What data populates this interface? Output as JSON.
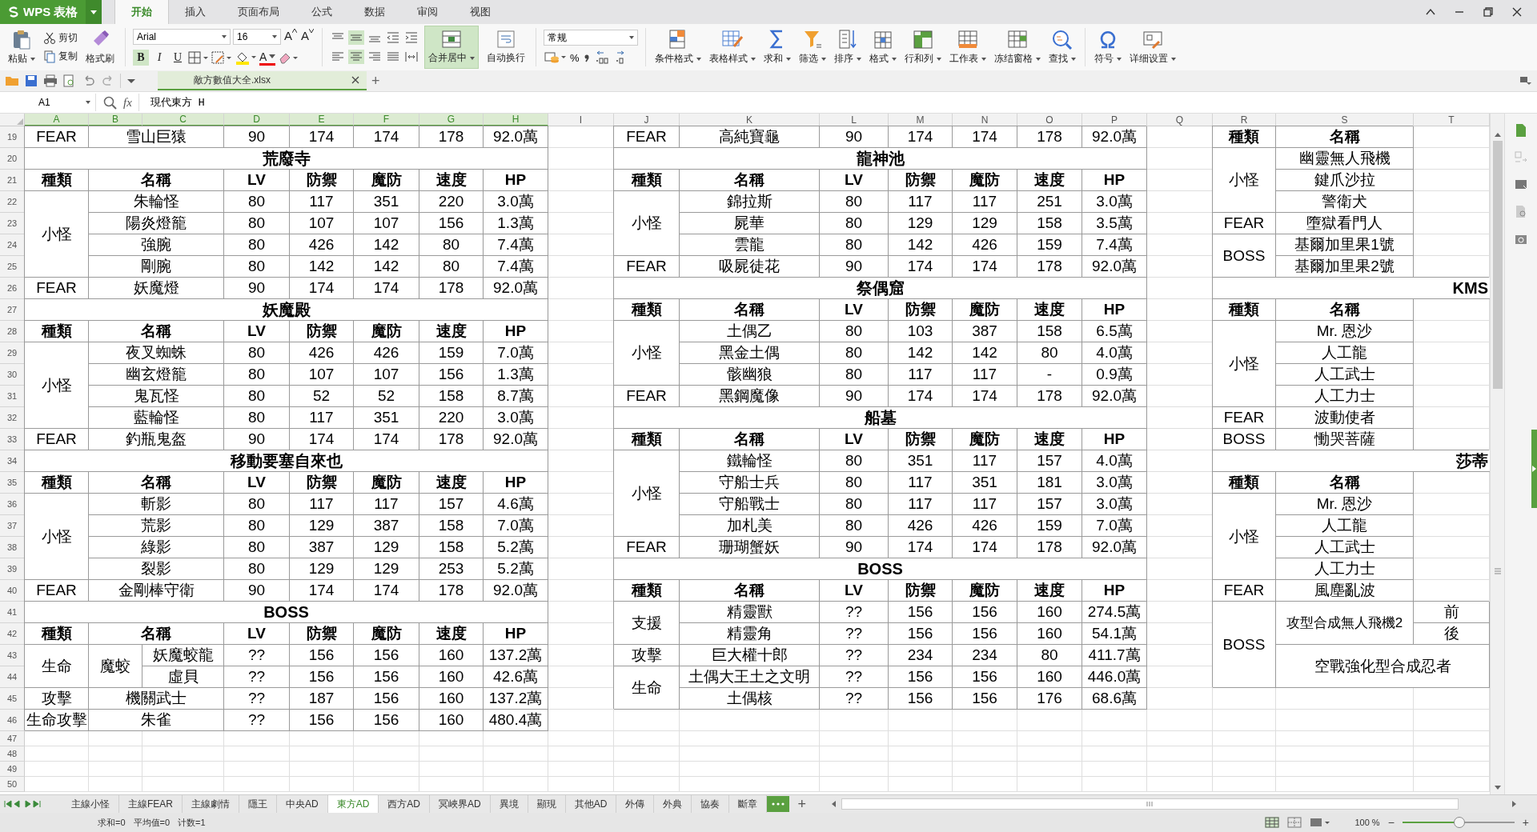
{
  "app": {
    "name": "WPS 表格"
  },
  "menu_tabs": [
    {
      "label": "开始",
      "selected": true
    },
    {
      "label": "插入",
      "selected": false
    },
    {
      "label": "页面布局",
      "selected": false
    },
    {
      "label": "公式",
      "selected": false
    },
    {
      "label": "数据",
      "selected": false
    },
    {
      "label": "审阅",
      "selected": false
    },
    {
      "label": "视图",
      "selected": false
    }
  ],
  "ribbon": {
    "paste": "粘贴",
    "cut": "剪切",
    "copy": "复制",
    "format_painter": "格式刷",
    "font": "Arial",
    "font_size": "16",
    "size_steps": [
      "A",
      "A"
    ],
    "styles": [
      {
        "label": "B",
        "selected": true
      },
      {
        "label": "I",
        "selected": false
      },
      {
        "label": "U",
        "selected": false
      }
    ],
    "font_color": "A",
    "vertical_align": [
      {
        "selected": false
      },
      {
        "selected": true
      },
      {
        "selected": false
      }
    ],
    "horizontal_align": [
      {
        "selected": false
      },
      {
        "selected": true
      },
      {
        "selected": false
      },
      {
        "selected": false
      }
    ],
    "merge": {
      "label": "合并居中",
      "selected": true
    },
    "wrap": {
      "label": "自动换行",
      "selected": false
    },
    "number_format": "常规",
    "percent": "%",
    "tools": [
      {
        "label": "条件格式",
        "kind": "conditional"
      },
      {
        "label": "表格样式",
        "kind": "table-style"
      },
      {
        "label": "求和",
        "kind": "sum"
      },
      {
        "label": "筛选",
        "kind": "filter"
      },
      {
        "label": "排序",
        "kind": "sort"
      },
      {
        "label": "格式",
        "kind": "format"
      },
      {
        "label": "行和列",
        "kind": "rows-cols"
      },
      {
        "label": "工作表",
        "kind": "sheet"
      },
      {
        "label": "冻结窗格",
        "kind": "freeze"
      },
      {
        "label": "查找",
        "kind": "find"
      },
      {
        "label": "符号",
        "kind": "symbol"
      },
      {
        "label": "详细设置",
        "kind": "settings"
      }
    ]
  },
  "quick_bar": {
    "document_tab": "敵方數值大全.xlsx",
    "new_tab": "+"
  },
  "formula_bar": {
    "cell": "A1",
    "fx": "fx",
    "value": "現代東方 H"
  },
  "sheet": {
    "columns": [
      {
        "label": "A",
        "selected": true
      },
      {
        "label": "B",
        "selected": true
      },
      {
        "label": "C",
        "selected": true
      },
      {
        "label": "D",
        "selected": true
      },
      {
        "label": "E",
        "selected": true
      },
      {
        "label": "F",
        "selected": true
      },
      {
        "label": "G",
        "selected": true
      },
      {
        "label": "H",
        "selected": true
      },
      {
        "label": "I",
        "selected": false
      },
      {
        "label": "J",
        "selected": false
      },
      {
        "label": "K",
        "selected": false
      },
      {
        "label": "L",
        "selected": false
      },
      {
        "label": "M",
        "selected": false
      },
      {
        "label": "N",
        "selected": false
      },
      {
        "label": "O",
        "selected": false
      },
      {
        "label": "P",
        "selected": false
      },
      {
        "label": "Q",
        "selected": false
      },
      {
        "label": "R",
        "selected": false
      },
      {
        "label": "S",
        "selected": false
      },
      {
        "label": "T",
        "selected": false
      }
    ],
    "rows": [
      "19",
      "20",
      "21",
      "22",
      "23",
      "24",
      "25",
      "26",
      "27",
      "28",
      "29",
      "30",
      "31",
      "32",
      "33",
      "34",
      "35",
      "36",
      "37",
      "38",
      "39",
      "40",
      "41",
      "42",
      "43",
      "44",
      "45",
      "46",
      "47",
      "48",
      "49",
      "50"
    ],
    "blocks": [
      {
        "entries": [
          {
            "kind": "group",
            "type": "FEAR",
            "rows": [
              [
                "雪山巨猿",
                "90",
                "174",
                "174",
                "178",
                "92.0萬"
              ]
            ]
          },
          {
            "kind": "title",
            "text": "荒廢寺",
            "cut": false
          },
          {
            "kind": "header",
            "cells": [
              "種類",
              "名稱",
              "LV",
              "防禦",
              "魔防",
              "速度",
              "HP"
            ]
          },
          {
            "kind": "group",
            "type": "小怪",
            "rows": [
              [
                "朱輪怪",
                "80",
                "117",
                "351",
                "220",
                "3.0萬"
              ],
              [
                "陽炎燈籠",
                "80",
                "107",
                "107",
                "156",
                "1.3萬"
              ],
              [
                "強腕",
                "80",
                "426",
                "142",
                "80",
                "7.4萬"
              ],
              [
                "剛腕",
                "80",
                "142",
                "142",
                "80",
                "7.4萬"
              ]
            ]
          },
          {
            "kind": "group",
            "type": "FEAR",
            "rows": [
              [
                "妖魔燈",
                "90",
                "174",
                "174",
                "178",
                "92.0萬"
              ]
            ]
          },
          {
            "kind": "title",
            "text": "妖魔殿",
            "cut": false
          },
          {
            "kind": "header",
            "cells": [
              "種類",
              "名稱",
              "LV",
              "防禦",
              "魔防",
              "速度",
              "HP"
            ]
          },
          {
            "kind": "group",
            "type": "小怪",
            "rows": [
              [
                "夜叉蜘蛛",
                "80",
                "426",
                "426",
                "159",
                "7.0萬"
              ],
              [
                "幽玄燈籠",
                "80",
                "107",
                "107",
                "156",
                "1.3萬"
              ],
              [
                "鬼瓦怪",
                "80",
                "52",
                "52",
                "158",
                "8.7萬"
              ],
              [
                "藍輪怪",
                "80",
                "117",
                "351",
                "220",
                "3.0萬"
              ]
            ]
          },
          {
            "kind": "group",
            "type": "FEAR",
            "rows": [
              [
                "釣瓶鬼盔",
                "90",
                "174",
                "174",
                "178",
                "92.0萬"
              ]
            ]
          },
          {
            "kind": "title",
            "text": "移動要塞自來也",
            "cut": false
          },
          {
            "kind": "header",
            "cells": [
              "種類",
              "名稱",
              "LV",
              "防禦",
              "魔防",
              "速度",
              "HP"
            ]
          },
          {
            "kind": "group",
            "type": "小怪",
            "rows": [
              [
                "斬影",
                "80",
                "117",
                "117",
                "157",
                "4.6萬"
              ],
              [
                "荒影",
                "80",
                "129",
                "387",
                "158",
                "7.0萬"
              ],
              [
                "綠影",
                "80",
                "387",
                "129",
                "158",
                "5.2萬"
              ],
              [
                "裂影",
                "80",
                "129",
                "129",
                "253",
                "5.2萬"
              ]
            ]
          },
          {
            "kind": "group",
            "type": "FEAR",
            "rows": [
              [
                "金剛棒守衛",
                "90",
                "174",
                "174",
                "178",
                "92.0萬"
              ]
            ]
          },
          {
            "kind": "title",
            "text": "BOSS",
            "cut": false
          },
          {
            "kind": "header",
            "cells": [
              "種類",
              "名稱",
              "LV",
              "防禦",
              "魔防",
              "速度",
              "HP"
            ]
          },
          {
            "kind": "group",
            "type": "生命",
            "subgroup": "魔蛟",
            "rows": [
              [
                "妖魔蛟龍",
                "??",
                "156",
                "156",
                "160",
                "137.2萬"
              ],
              [
                "虛貝",
                "??",
                "156",
                "156",
                "160",
                "42.6萬"
              ]
            ]
          },
          {
            "kind": "group",
            "type": "攻擊",
            "rows": [
              [
                "機關武士",
                "??",
                "187",
                "156",
                "160",
                "137.2萬"
              ]
            ]
          },
          {
            "kind": "group",
            "type": "生命攻擊",
            "rows": [
              [
                "朱雀",
                "??",
                "156",
                "156",
                "160",
                "480.4萬"
              ]
            ]
          }
        ]
      },
      {
        "entries": [
          {
            "kind": "group",
            "type": "FEAR",
            "rows": [
              [
                "高純寶龜",
                "90",
                "174",
                "174",
                "178",
                "92.0萬"
              ]
            ]
          },
          {
            "kind": "title",
            "text": "龍神池",
            "cut": false
          },
          {
            "kind": "header",
            "cells": [
              "種類",
              "名稱",
              "LV",
              "防禦",
              "魔防",
              "速度",
              "HP"
            ]
          },
          {
            "kind": "group",
            "type": "小怪",
            "rows": [
              [
                "錦拉斯",
                "80",
                "117",
                "117",
                "251",
                "3.0萬"
              ],
              [
                "屍華",
                "80",
                "129",
                "129",
                "158",
                "3.5萬"
              ],
              [
                "雲龍",
                "80",
                "142",
                "426",
                "159",
                "7.4萬"
              ]
            ]
          },
          {
            "kind": "group",
            "type": "FEAR",
            "rows": [
              [
                "吸屍徒花",
                "90",
                "174",
                "174",
                "178",
                "92.0萬"
              ]
            ]
          },
          {
            "kind": "title",
            "text": "祭偶窟",
            "cut": false
          },
          {
            "kind": "header",
            "cells": [
              "種類",
              "名稱",
              "LV",
              "防禦",
              "魔防",
              "速度",
              "HP"
            ]
          },
          {
            "kind": "group",
            "type": "小怪",
            "rows": [
              [
                "土偶乙",
                "80",
                "103",
                "387",
                "158",
                "6.5萬"
              ],
              [
                "黑金土偶",
                "80",
                "142",
                "142",
                "80",
                "4.0萬"
              ],
              [
                "骸幽狼",
                "80",
                "117",
                "117",
                "-",
                "0.9萬"
              ]
            ]
          },
          {
            "kind": "group",
            "type": "FEAR",
            "rows": [
              [
                "黑鋼魔像",
                "90",
                "174",
                "174",
                "178",
                "92.0萬"
              ]
            ]
          },
          {
            "kind": "title",
            "text": "船墓",
            "cut": false
          },
          {
            "kind": "header",
            "cells": [
              "種類",
              "名稱",
              "LV",
              "防禦",
              "魔防",
              "速度",
              "HP"
            ]
          },
          {
            "kind": "group",
            "type": "小怪",
            "rows": [
              [
                "鐵輪怪",
                "80",
                "351",
                "117",
                "157",
                "4.0萬"
              ],
              [
                "守船士兵",
                "80",
                "117",
                "351",
                "181",
                "3.0萬"
              ],
              [
                "守船戰士",
                "80",
                "117",
                "117",
                "157",
                "3.0萬"
              ],
              [
                "加札美",
                "80",
                "426",
                "426",
                "159",
                "7.0萬"
              ]
            ]
          },
          {
            "kind": "group",
            "type": "FEAR",
            "rows": [
              [
                "珊瑚蟹妖",
                "90",
                "174",
                "174",
                "178",
                "92.0萬"
              ]
            ]
          },
          {
            "kind": "title",
            "text": "BOSS",
            "cut": false
          },
          {
            "kind": "header",
            "cells": [
              "種類",
              "名稱",
              "LV",
              "防禦",
              "魔防",
              "速度",
              "HP"
            ]
          },
          {
            "kind": "group",
            "type": "支援",
            "rows": [
              [
                "精靈獸",
                "??",
                "156",
                "156",
                "160",
                "274.5萬"
              ],
              [
                "精靈角",
                "??",
                "156",
                "156",
                "160",
                "54.1萬"
              ]
            ]
          },
          {
            "kind": "group",
            "type": "攻擊",
            "rows": [
              [
                "巨大權十郎",
                "??",
                "234",
                "234",
                "80",
                "411.7萬"
              ]
            ]
          },
          {
            "kind": "group",
            "type": "生命",
            "rows": [
              [
                "土偶大王土之文明",
                "??",
                "156",
                "156",
                "160",
                "446.0萬"
              ],
              [
                "土偶核",
                "??",
                "156",
                "156",
                "176",
                "68.6萬"
              ]
            ]
          }
        ]
      },
      {
        "entries": [
          {
            "kind": "header",
            "cells": [
              "種類",
              "名稱"
            ]
          },
          {
            "kind": "group",
            "type": "小怪",
            "rows": [
              [
                "幽靈無人飛機"
              ],
              [
                "鍵爪沙拉"
              ],
              [
                "警衛犬"
              ]
            ]
          },
          {
            "kind": "group",
            "type": "FEAR",
            "rows": [
              [
                "墮獄看門人"
              ]
            ]
          },
          {
            "kind": "group",
            "type": "BOSS",
            "rows": [
              [
                "基爾加里果1號"
              ],
              [
                "基爾加里果2號"
              ]
            ]
          },
          {
            "kind": "title",
            "text": "KMS",
            "cut": true
          },
          {
            "kind": "header",
            "cells": [
              "種類",
              "名稱"
            ]
          },
          {
            "kind": "group",
            "type": "小怪",
            "rows": [
              [
                "Mr. 恩沙"
              ],
              [
                "人工龍"
              ],
              [
                "人工武士"
              ],
              [
                "人工力士"
              ]
            ]
          },
          {
            "kind": "group",
            "type": "FEAR",
            "rows": [
              [
                "波動使者"
              ]
            ]
          },
          {
            "kind": "group",
            "type": "BOSS",
            "rows": [
              [
                "慟哭菩薩"
              ]
            ]
          },
          {
            "kind": "title",
            "text": "莎蒂",
            "cut": true
          },
          {
            "kind": "header",
            "cells": [
              "種類",
              "名稱"
            ]
          },
          {
            "kind": "group",
            "type": "小怪",
            "rows": [
              [
                "Mr. 恩沙"
              ],
              [
                "人工龍"
              ],
              [
                "人工武士"
              ],
              [
                "人工力士"
              ]
            ]
          },
          {
            "kind": "group",
            "type": "FEAR",
            "rows": [
              [
                "風塵亂波"
              ]
            ]
          },
          {
            "kind": "split",
            "type": "BOSS",
            "items": [
              {
                "name": "攻型合成無人飛機2",
                "parts": [
                  "前",
                  "後"
                ]
              },
              {
                "name": "空戰強化型合成忍者"
              }
            ]
          }
        ]
      }
    ]
  },
  "sheet_tabs": [
    {
      "label": "主線小怪",
      "selected": false
    },
    {
      "label": "主線FEAR",
      "selected": false
    },
    {
      "label": "主線劇情",
      "selected": false
    },
    {
      "label": "隱王",
      "selected": false
    },
    {
      "label": "中央AD",
      "selected": false
    },
    {
      "label": "東方AD",
      "selected": true
    },
    {
      "label": "西方AD",
      "selected": false
    },
    {
      "label": "冥峽界AD",
      "selected": false
    },
    {
      "label": "異境",
      "selected": false
    },
    {
      "label": "顯現",
      "selected": false
    },
    {
      "label": "其他AD",
      "selected": false
    },
    {
      "label": "外傳",
      "selected": false
    },
    {
      "label": "外典",
      "selected": false
    },
    {
      "label": "協奏",
      "selected": false
    },
    {
      "label": "斷章",
      "selected": false
    }
  ],
  "add_sheet": "+",
  "status_bar": {
    "sum": "求和=0",
    "average": "平均值=0",
    "count": "计数=1",
    "zoom": "100 %",
    "zoom_out": "−",
    "zoom_in": "+",
    "zoom_slider": {
      "level": 0.5
    }
  }
}
